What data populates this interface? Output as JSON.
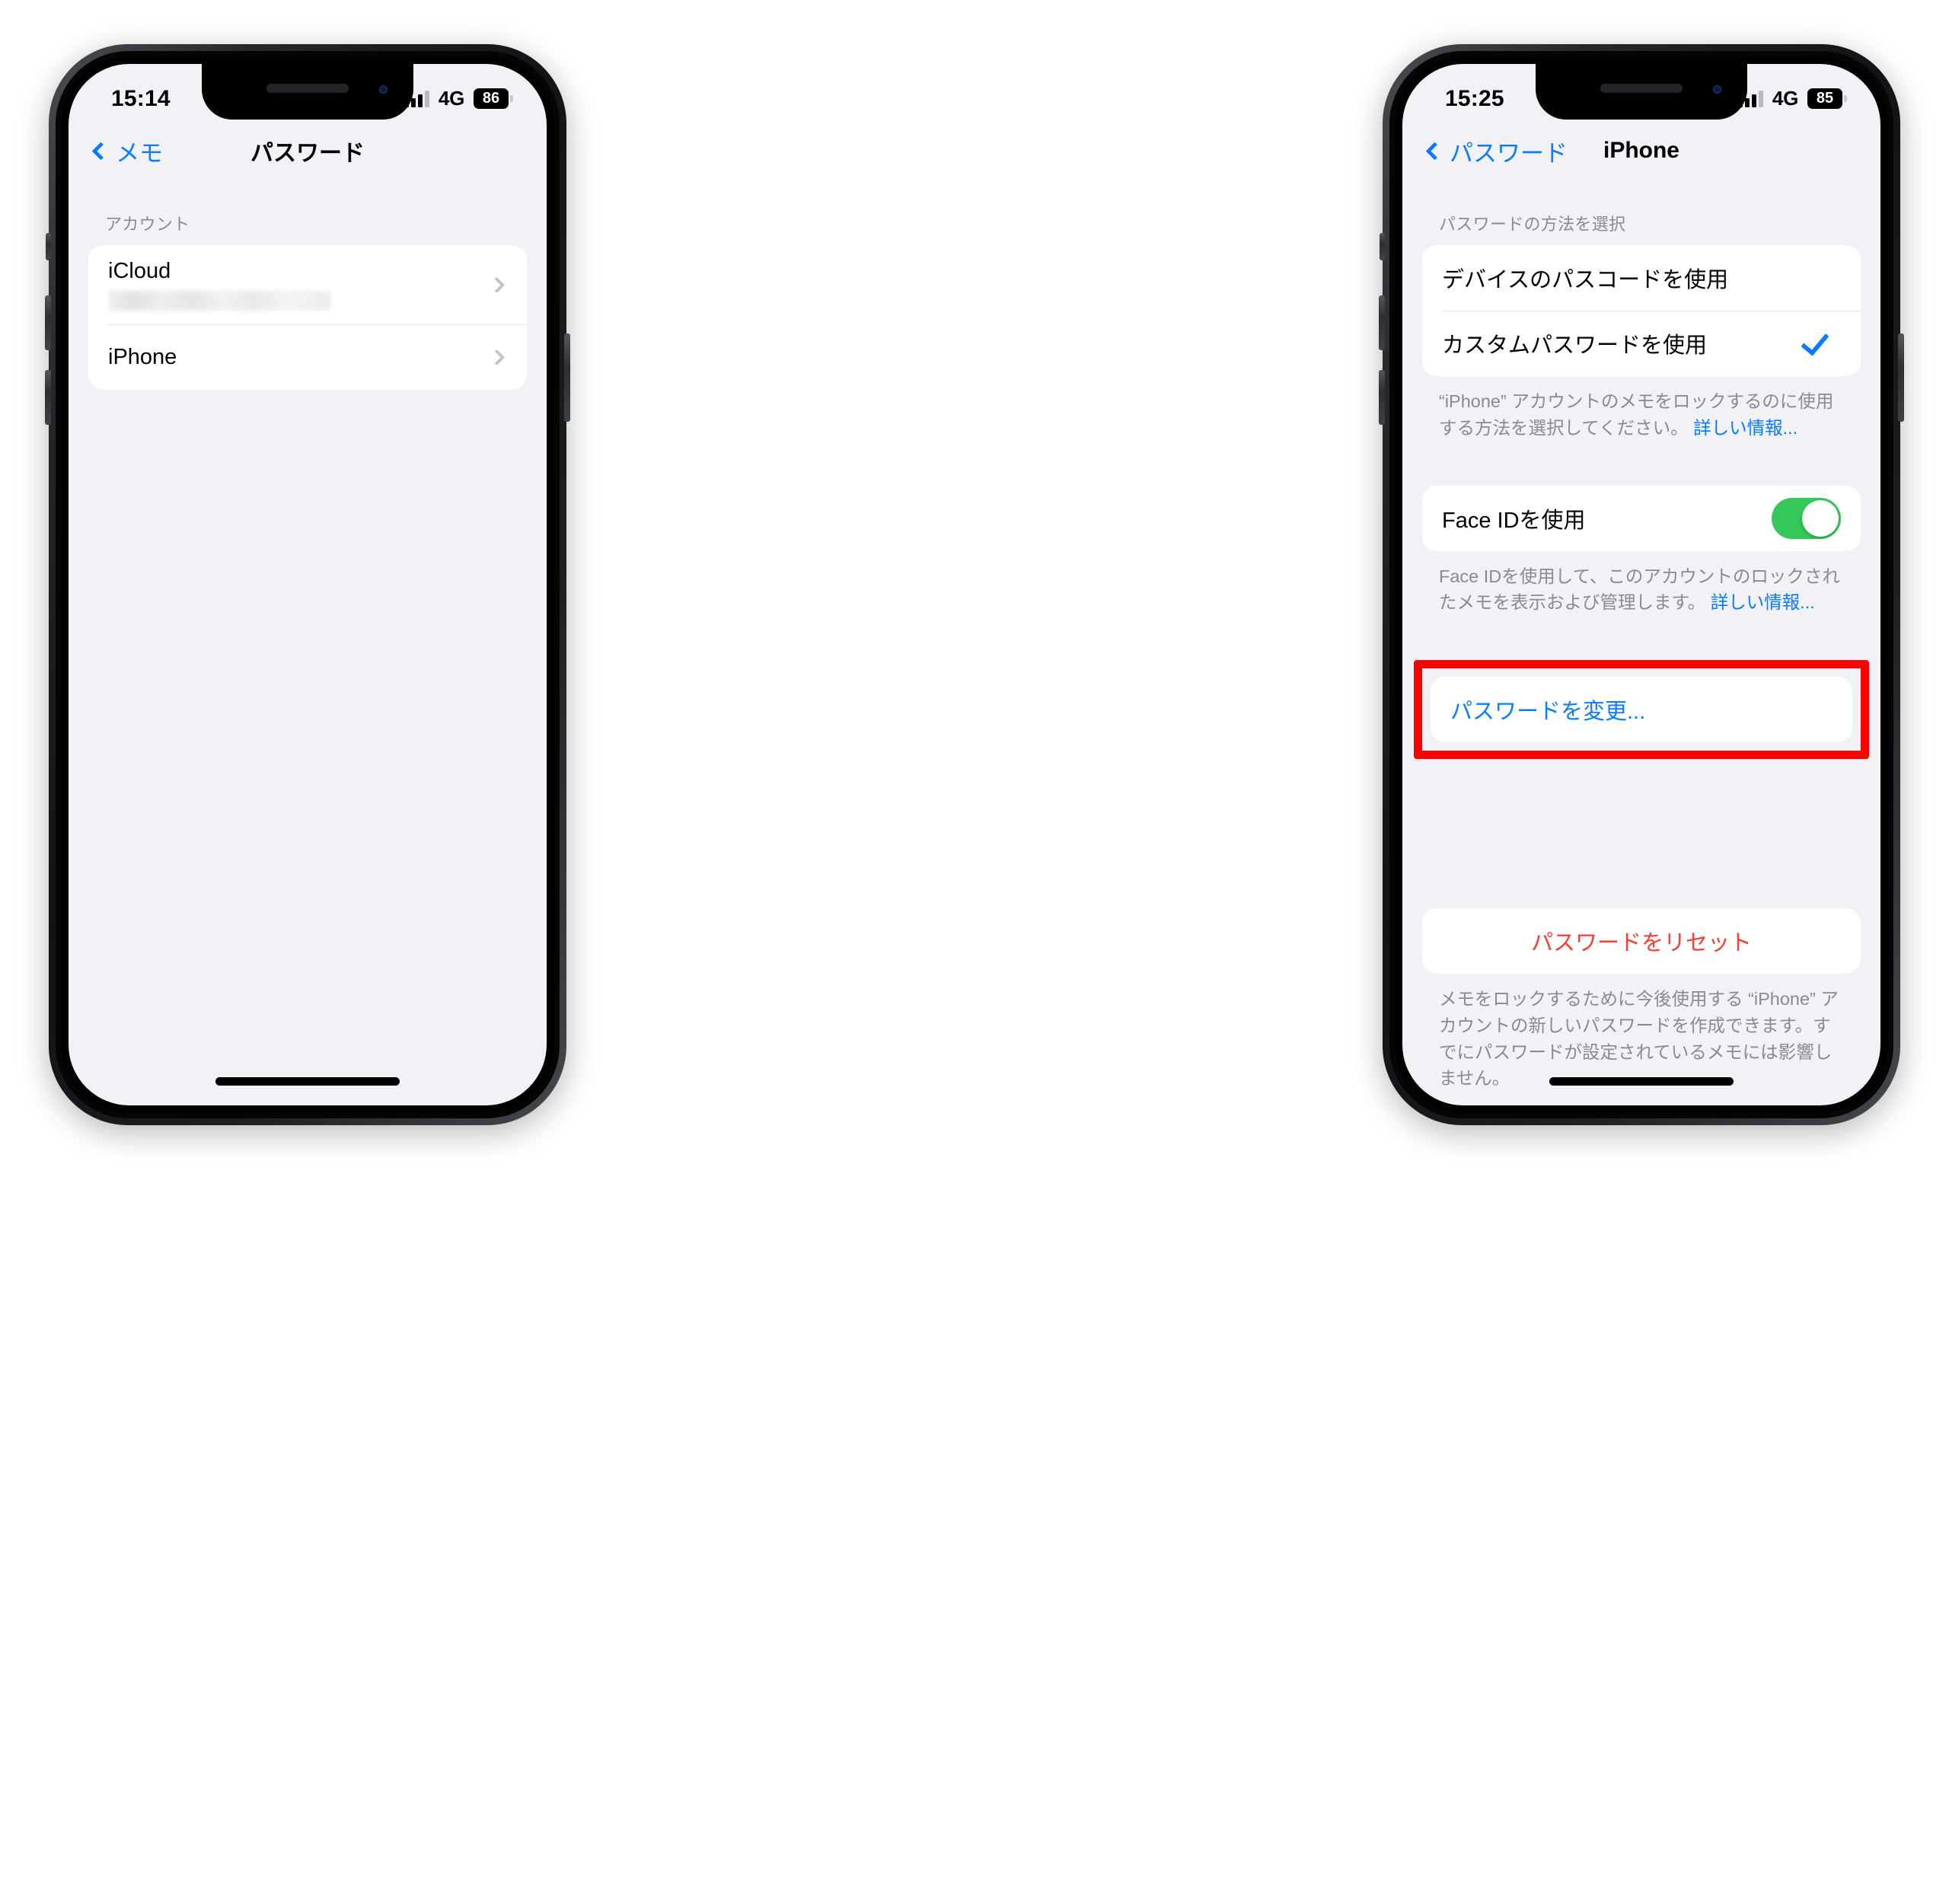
{
  "phones": [
    {
      "id": "left",
      "status": {
        "time": "15:14",
        "network": "4G",
        "battery": "86",
        "signal_icon": "cellular-bars-icon",
        "battery_icon": "battery-icon"
      },
      "nav": {
        "back_label": "メモ",
        "back_icon": "chevron-left-icon",
        "title": "パスワード"
      },
      "section_header": "アカウント",
      "rows": [
        {
          "label": "iCloud",
          "has_blurred_detail": true,
          "accessory": "chevron-right-icon"
        },
        {
          "label": "iPhone",
          "has_blurred_detail": false,
          "accessory": "chevron-right-icon"
        }
      ]
    },
    {
      "id": "right",
      "status": {
        "time": "15:25",
        "network": "4G",
        "battery": "85",
        "signal_icon": "cellular-bars-icon",
        "battery_icon": "battery-icon"
      },
      "nav": {
        "back_label": "パスワード",
        "back_icon": "chevron-left-icon",
        "title": "iPhone"
      },
      "method_section": {
        "header": "パスワードの方法を選択",
        "options": [
          {
            "label": "デバイスのパスコードを使用",
            "selected": false
          },
          {
            "label": "カスタムパスワードを使用",
            "selected": true,
            "accessory": "checkmark-icon"
          }
        ],
        "footnote_text": "“iPhone” アカウントのメモをロックするのに使用する方法を選択してください。 ",
        "footnote_link": "詳しい情報..."
      },
      "faceid_section": {
        "label": "Face IDを使用",
        "toggle_on": true,
        "footnote_text": "Face IDを使用して、このアカウントのロックされたメモを表示および管理します。 ",
        "footnote_link": "詳しい情報..."
      },
      "change_password": {
        "label": "パスワードを変更...",
        "highlighted": true,
        "highlight_color": "#ff0000"
      },
      "reset_section": {
        "label": "パスワードをリセット",
        "color": "#ff3b30",
        "footnote_text": "メモをロックするために今後使用する “iPhone” アカウントの新しいパスワードを作成できます。すでにパスワードが設定されているメモには影響しません。"
      }
    }
  ],
  "colors": {
    "accent_blue": "#0a7cff",
    "danger_red": "#ff3b30",
    "highlight_red": "#ff0000",
    "toggle_green": "#34c759",
    "page_bg": "#f1f1f6",
    "card_bg": "#ffffff",
    "secondary_text": "#8a8a8f"
  }
}
